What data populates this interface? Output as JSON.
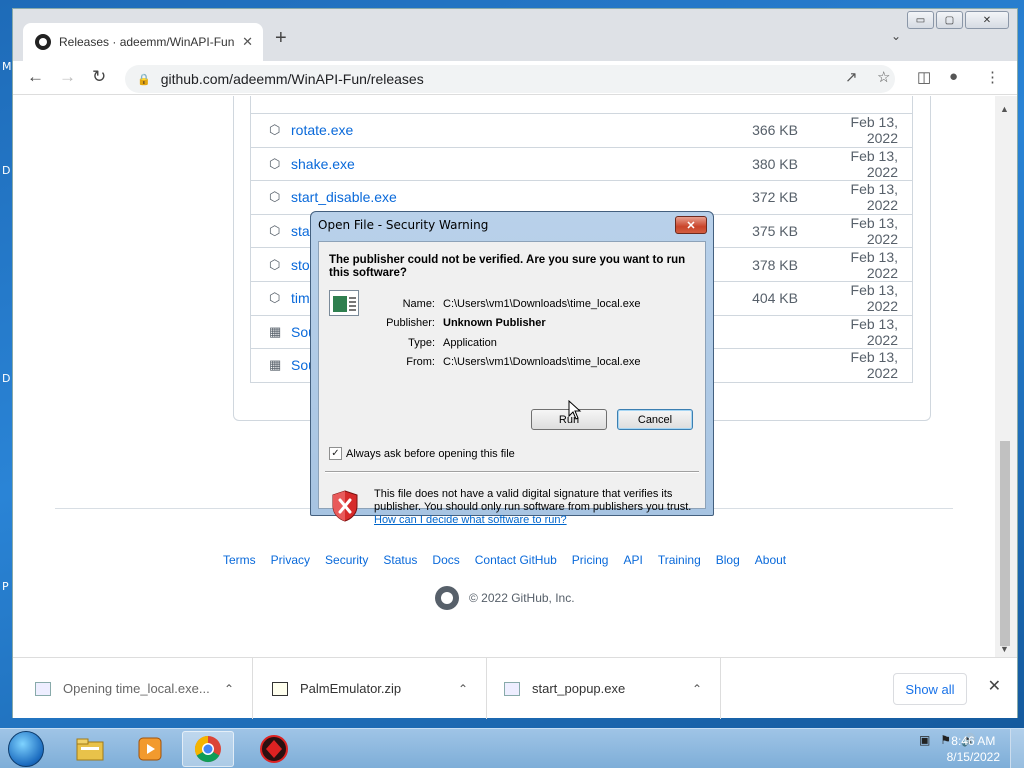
{
  "browser": {
    "tab_title": "Releases · adeemm/WinAPI-Fun",
    "tab_close": "✕",
    "new_tab": "+",
    "url": "github.com/adeemm/WinAPI-Fun/releases",
    "win_min": "▭",
    "win_max": "▢",
    "win_close": "✕"
  },
  "desktop_letters": [
    "M",
    "D",
    "D",
    "P"
  ],
  "assets": [
    {
      "name": "rotate.exe",
      "size": "366 KB",
      "date": "Feb 13, 2022",
      "icon": "package-icon"
    },
    {
      "name": "shake.exe",
      "size": "380 KB",
      "date": "Feb 13, 2022",
      "icon": "package-icon"
    },
    {
      "name": "start_disable.exe",
      "size": "372 KB",
      "date": "Feb 13, 2022",
      "icon": "package-icon"
    },
    {
      "name": "star",
      "size": "375 KB",
      "date": "Feb 13, 2022",
      "icon": "package-icon"
    },
    {
      "name": "stop",
      "size": "378 KB",
      "date": "Feb 13, 2022",
      "icon": "package-icon"
    },
    {
      "name": "time",
      "size": "404 KB",
      "date": "Feb 13, 2022",
      "icon": "package-icon"
    },
    {
      "name": "Sou",
      "size": "",
      "date": "Feb 13, 2022",
      "icon": "zip-icon"
    },
    {
      "name": "Sou",
      "size": "",
      "date": "Feb 13, 2022",
      "icon": "zip-icon"
    }
  ],
  "footer": {
    "links": [
      "Terms",
      "Privacy",
      "Security",
      "Status",
      "Docs",
      "Contact GitHub",
      "Pricing",
      "API",
      "Training",
      "Blog",
      "About"
    ],
    "copyright": "© 2022 GitHub, Inc."
  },
  "downloads": {
    "items": [
      {
        "name": "Opening time_local.exe..."
      },
      {
        "name": "PalmEmulator.zip"
      },
      {
        "name": "start_popup.exe"
      }
    ],
    "show_all": "Show all",
    "close": "✕"
  },
  "dialog": {
    "title": "Open File - Security Warning",
    "close": "✕",
    "headline": "The publisher could not be verified.  Are you sure you want to run this software?",
    "name_label": "Name:",
    "name_value": "C:\\Users\\vm1\\Downloads\\time_local.exe",
    "publisher_label": "Publisher:",
    "publisher_value": "Unknown Publisher",
    "type_label": "Type:",
    "type_value": "Application",
    "from_label": "From:",
    "from_value": "C:\\Users\\vm1\\Downloads\\time_local.exe",
    "run_label": "Run",
    "cancel_label": "Cancel",
    "checkbox_label": "Always ask before opening this file",
    "checkbox_checked": true,
    "warning_text": "This file does not have a valid digital signature that verifies its publisher.  You should only run software from publishers you trust.",
    "warning_link": "How can I decide what software to run?"
  },
  "taskbar": {
    "time": "8:46 AM",
    "date": "8/15/2022"
  }
}
